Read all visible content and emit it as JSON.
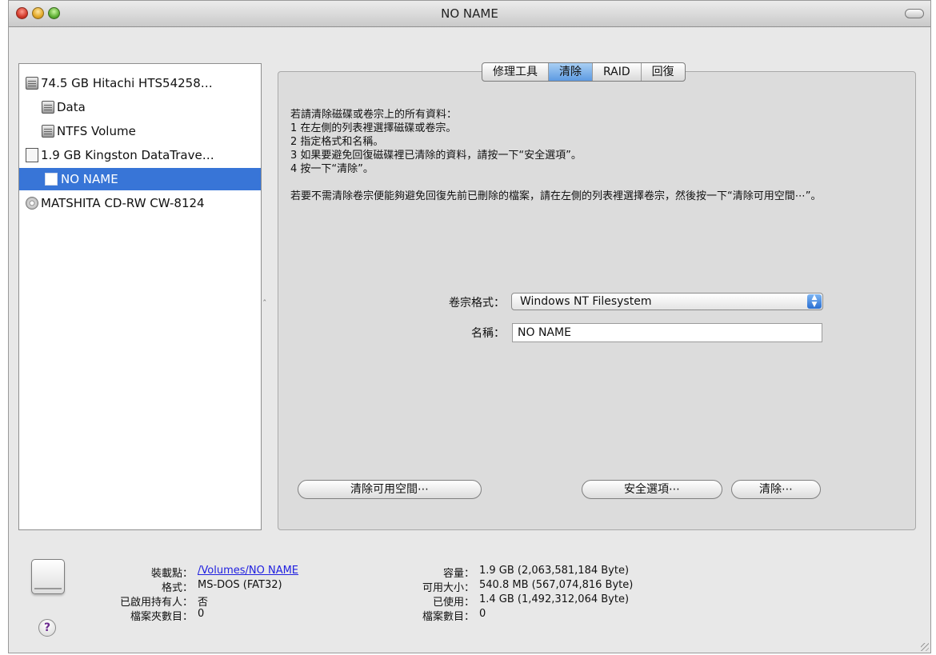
{
  "window": {
    "title": "NO NAME"
  },
  "sidebar": {
    "items": [
      {
        "label": "74.5 GB Hitachi HTS54258…",
        "icon": "hard-disk-icon"
      },
      {
        "label": "Data",
        "icon": "volume-icon"
      },
      {
        "label": "NTFS Volume",
        "icon": "volume-icon"
      },
      {
        "label": "1.9 GB Kingston DataTrave…",
        "icon": "usb-drive-icon"
      },
      {
        "label": "NO NAME",
        "icon": "volume-icon",
        "selected": true
      },
      {
        "label": "MATSHITA CD-RW CW-8124",
        "icon": "cd-drive-icon"
      }
    ]
  },
  "tabs": [
    {
      "label": "修理工具"
    },
    {
      "label": "清除",
      "active": true
    },
    {
      "label": "RAID"
    },
    {
      "label": "回復"
    }
  ],
  "erase": {
    "instructions": [
      "若請清除磁碟或卷宗上的所有資料：",
      "1 在左側的列表裡選擇磁碟或卷宗。",
      "2 指定格式和名稱。",
      "3 如果要避免回復磁碟裡已清除的資料，請按一下“安全選項”。",
      "4 按一下“清除”。"
    ],
    "free_space_note": "若要不需清除卷宗便能夠避免回復先前已刪除的檔案，請在左側的列表裡選擇卷宗，然後按一下“清除可用空間⋯”。",
    "format_label": "卷宗格式：",
    "format_value": "Windows NT Filesystem",
    "name_label": "名稱：",
    "name_value": "NO NAME",
    "erase_free_space_button": "清除可用空間⋯",
    "security_options_button": "安全選項⋯",
    "erase_button": "清除⋯"
  },
  "info": {
    "mount_point_label": "裝載點：",
    "mount_point_value": "/Volumes/NO NAME",
    "format_label": "格式：",
    "format_value": "MS-DOS (FAT32)",
    "owners_label": "已啟用持有人：",
    "owners_value": "否",
    "folders_label": "檔案夾數目：",
    "folders_value": "0",
    "capacity_label": "容量：",
    "capacity_value": "1.9 GB (2,063,581,184 Byte)",
    "available_label": "可用大小：",
    "available_value": "540.8 MB (567,074,816 Byte)",
    "used_label": "已使用：",
    "used_value": "1.4 GB (1,492,312,064 Byte)",
    "files_label": "檔案數目：",
    "files_value": "0",
    "help_symbol": "?"
  }
}
